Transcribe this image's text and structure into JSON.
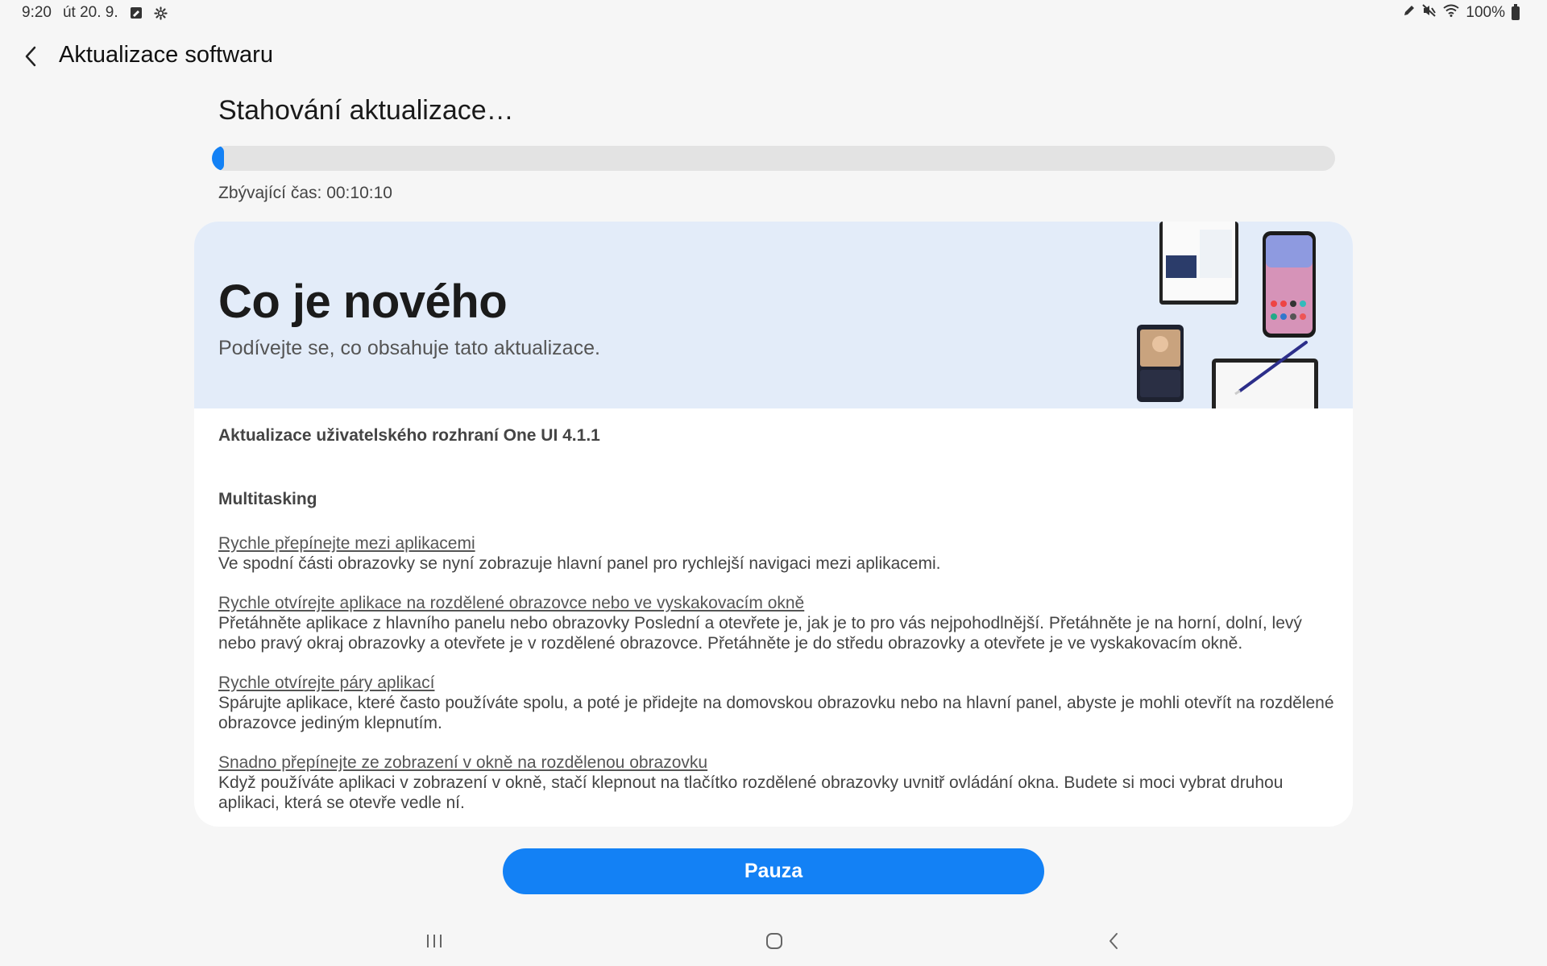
{
  "status_bar": {
    "time": "9:20",
    "date": "út 20. 9.",
    "battery": "100%",
    "icons_left": [
      "note-icon",
      "gear-icon"
    ],
    "icons_right": [
      "pen-icon",
      "mute-icon",
      "wifi-icon",
      "battery-icon"
    ]
  },
  "app_bar": {
    "title": "Aktualizace softwaru"
  },
  "download": {
    "title": "Stahování aktualizace…",
    "progress": 0.01,
    "remaining_label": "Zbývající čas: 00:10:10"
  },
  "whats_new": {
    "title": "Co je nového",
    "subtitle": "Podívejte se, co obsahuje tato aktualizace.",
    "heading": "Aktualizace uživatelského rozhraní One UI 4.1.1",
    "section": "Multitasking",
    "items": [
      {
        "title": "Rychle přepínejte mezi aplikacemi",
        "desc": "Ve spodní části obrazovky se nyní zobrazuje hlavní panel pro rychlejší navigaci mezi aplikacemi."
      },
      {
        "title": "Rychle otvírejte aplikace na rozdělené obrazovce nebo ve vyskakovacím okně",
        "desc": "Přetáhněte aplikace z hlavního panelu nebo obrazovky Poslední a otevřete je, jak je to pro vás nejpohodlnější. Přetáhněte je na horní, dolní, levý nebo pravý okraj obrazovky a otevřete je v rozdělené obrazovce. Přetáhněte je do středu obrazovky a otevřete je ve vyskakovacím okně."
      },
      {
        "title": "Rychle otvírejte páry aplikací",
        "desc": "Spárujte aplikace, které často používáte spolu, a poté je přidejte na domovskou obrazovku nebo na hlavní panel, abyste je mohli otevřít na rozdělené obrazovce jediným klepnutím."
      },
      {
        "title": "Snadno přepínejte ze zobrazení v okně na rozdělenou obrazovku",
        "desc": "Když používáte aplikaci v zobrazení v okně, stačí klepnout na tlačítko rozdělené obrazovky uvnitř ovládání okna. Budete si moci vybrat druhou aplikaci, která se otevře vedle ní."
      }
    ]
  },
  "pause_button": "Pauza",
  "colors": {
    "accent": "#1381f5",
    "hero_bg": "#e3ecf9",
    "page_bg": "#f6f6f6"
  }
}
